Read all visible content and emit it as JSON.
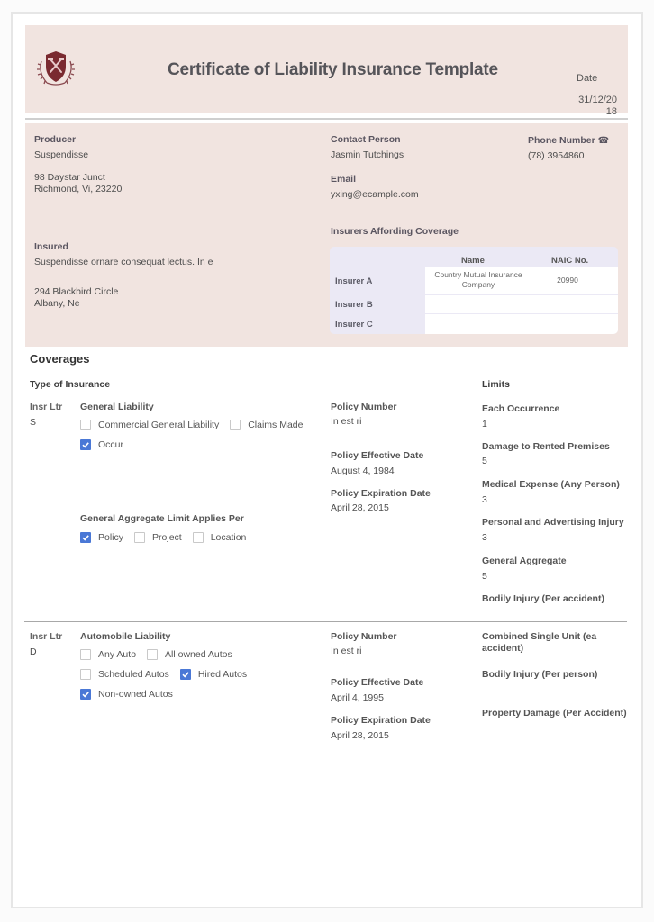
{
  "header": {
    "title": "Certificate of Liability Insurance Template",
    "logo_icon": "crest-shield-hammers-icon",
    "date_label": "Date",
    "date_value": "31/12/2018"
  },
  "producer": {
    "label": "Producer",
    "name": "Suspendisse",
    "address_line1": "98 Daystar Junct",
    "address_line2": "Richmond, Vi, 23220"
  },
  "contact": {
    "label": "Contact Person",
    "name": "Jasmin Tutchings",
    "email_label": "Email",
    "email": "yxing@ecample.com",
    "phone_label": "Phone Number",
    "phone_icon": "telephone-icon",
    "phone": "(78) 3954860"
  },
  "insured": {
    "label": "Insured",
    "name": "Suspendisse ornare consequat lectus. In e",
    "address_line1": "294 Blackbird Circle",
    "address_line2": "Albany, Ne"
  },
  "insurers": {
    "title": "Insurers Affording Coverage",
    "columns": [
      "Name",
      "NAIC No."
    ],
    "rows": [
      {
        "label": "Insurer A",
        "name": "Country Mutual Insurance Company",
        "naic": "20990"
      },
      {
        "label": "Insurer B",
        "name": "",
        "naic": ""
      },
      {
        "label": "Insurer C",
        "name": "",
        "naic": ""
      }
    ]
  },
  "coverages": {
    "title": "Coverages",
    "type_label": "Type of Insurance",
    "limits_label": "Limits",
    "general": {
      "insr_ltr_label": "Insr Ltr",
      "insr_ltr": "S",
      "title": "General Liability",
      "options": [
        {
          "label": "Commercial General Liability",
          "checked": false
        },
        {
          "label": "Claims Made",
          "checked": false
        },
        {
          "label": "Occur",
          "checked": true
        }
      ],
      "aggregate_title": "General Aggregate Limit Applies Per",
      "aggregate_options": [
        {
          "label": "Policy",
          "checked": true
        },
        {
          "label": "Project",
          "checked": false
        },
        {
          "label": "Location",
          "checked": false
        }
      ],
      "policy_number_label": "Policy Number",
      "policy_number": "In est ri",
      "effective_label": "Policy Effective Date",
      "effective": "August 4, 1984",
      "expiration_label": "Policy Expiration Date",
      "expiration": "April 28, 2015",
      "limits": [
        {
          "label": "Each Occurrence",
          "value": "1"
        },
        {
          "label": "Damage to Rented Premises",
          "value": "5"
        },
        {
          "label": "Medical Expense (Any Person)",
          "value": "3"
        },
        {
          "label": "Personal and Advertising Injury",
          "value": "3"
        },
        {
          "label": "General Aggregate",
          "value": "5"
        },
        {
          "label": "Bodily Injury (Per accident)",
          "value": ""
        }
      ]
    },
    "auto": {
      "insr_ltr_label": "Insr Ltr",
      "insr_ltr": "D",
      "title": "Automobile Liability",
      "options": [
        {
          "label": "Any Auto",
          "checked": false
        },
        {
          "label": "All owned Autos",
          "checked": false
        },
        {
          "label": "Scheduled Autos",
          "checked": false
        },
        {
          "label": "Hired Autos",
          "checked": true
        },
        {
          "label": "Non-owned Autos",
          "checked": true
        }
      ],
      "policy_number_label": "Policy Number",
      "policy_number": "In est ri",
      "effective_label": "Policy Effective Date",
      "effective": "April 4, 1995",
      "expiration_label": "Policy Expiration Date",
      "expiration": "April 28, 2015",
      "limits": [
        {
          "label": "Combined Single Unit (ea accident)",
          "value": ""
        },
        {
          "label": "Bodily Injury (Per person)",
          "value": ""
        },
        {
          "label": "Property Damage (Per Accident)",
          "value": ""
        }
      ]
    }
  },
  "colors": {
    "panel_bg": "#f1e4e0",
    "checkbox_checked": "#4a78d6",
    "logo_red": "#7a2a30"
  }
}
